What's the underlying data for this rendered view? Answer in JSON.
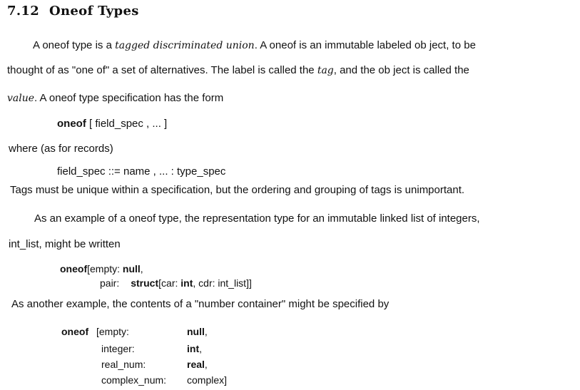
{
  "section": {
    "number": "7.12",
    "title": "Oneof Types"
  },
  "para1": {
    "line1": {
      "a": "A oneof type is a ",
      "em1": "tagged discriminated union",
      "b": ".  A oneof is an immutable labeled ob ject, to be"
    },
    "line2": {
      "a": "thought of as \"one of\" a set of alternatives.  The label is called the ",
      "em": "tag",
      "b": ", and the ob ject is called the"
    },
    "line3": {
      "em": "value",
      "b": ".  A oneof type specification has the form"
    }
  },
  "form1": {
    "kw": "oneof",
    "rest": " [ field_spec , ... ]"
  },
  "where_line": "where (as for records)",
  "form2": "field_spec  ::=  name , ... : type_spec",
  "tags_line": "Tags must be unique within a specification, but the ordering and grouping of tags is unimportant.",
  "para2": {
    "line1": "As an example of a oneof type, the representation type for an immutable linked list of integers,",
    "line2": "int_list, might be written"
  },
  "example1": {
    "l1_kw": "oneof",
    "l1_rest": "[empty: ",
    "l1_val": "null",
    "l1_end": ",",
    "l2_field": "pair:",
    "l2_kw": "struct",
    "l2_a": "[car: ",
    "l2_int": "int",
    "l2_b": ", cdr: int_list]]"
  },
  "another_line": "As another example, the contents of a \"number container\" might be specified by",
  "example2": {
    "kw": "oneof",
    "rows": [
      {
        "field": "[empty:",
        "type": "null",
        "end": ","
      },
      {
        "field": "integer:",
        "type": "int",
        "end": ","
      },
      {
        "field": "real_num:",
        "type": "real",
        "end": ","
      },
      {
        "field": "complex_num:",
        "type": "complex",
        "end": "]"
      }
    ]
  }
}
